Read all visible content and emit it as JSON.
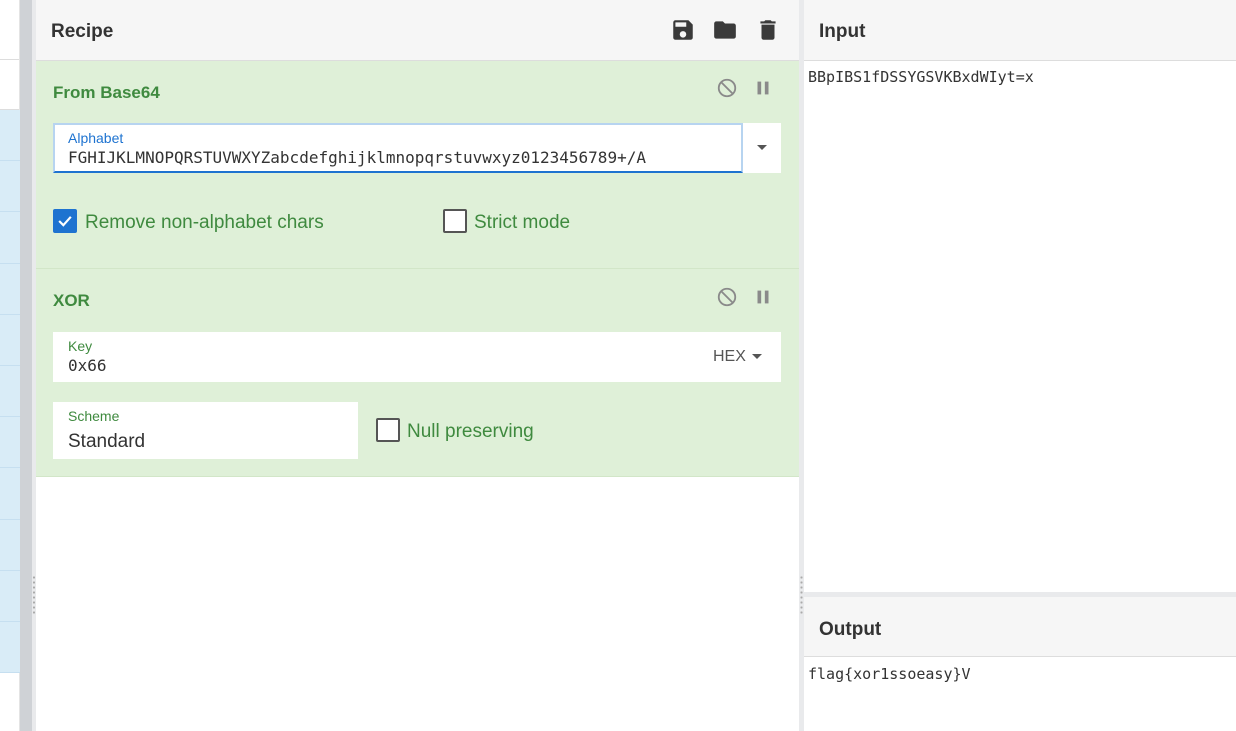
{
  "recipe": {
    "title": "Recipe",
    "icons": [
      "save-icon",
      "folder-icon",
      "trash-icon"
    ],
    "operations": [
      {
        "name": "From Base64",
        "alphabet_label": "Alphabet",
        "alphabet_value": "FGHIJKLMNOPQRSTUVWXYZabcdefghijklmnopqrstuvwxyz0123456789+/A",
        "remove_non_alphabet_label": "Remove non-alphabet chars",
        "remove_non_alphabet_checked": true,
        "strict_mode_label": "Strict mode",
        "strict_mode_checked": false
      },
      {
        "name": "XOR",
        "key_label": "Key",
        "key_value": "0x66",
        "key_format": "HEX",
        "scheme_label": "Scheme",
        "scheme_value": "Standard",
        "null_preserving_label": "Null preserving",
        "null_preserving_checked": false
      }
    ]
  },
  "input": {
    "title": "Input",
    "value": "BBpIBS1fDSSYGSVKBxdWIyt=x"
  },
  "output": {
    "title": "Output",
    "value": "flag{xor1ssoeasy}V"
  },
  "colors": {
    "accent_green": "#3f8a3f",
    "op_background": "#dff0d8",
    "checkbox_blue": "#1e73d0",
    "focus_blue": "#1e73d0"
  }
}
